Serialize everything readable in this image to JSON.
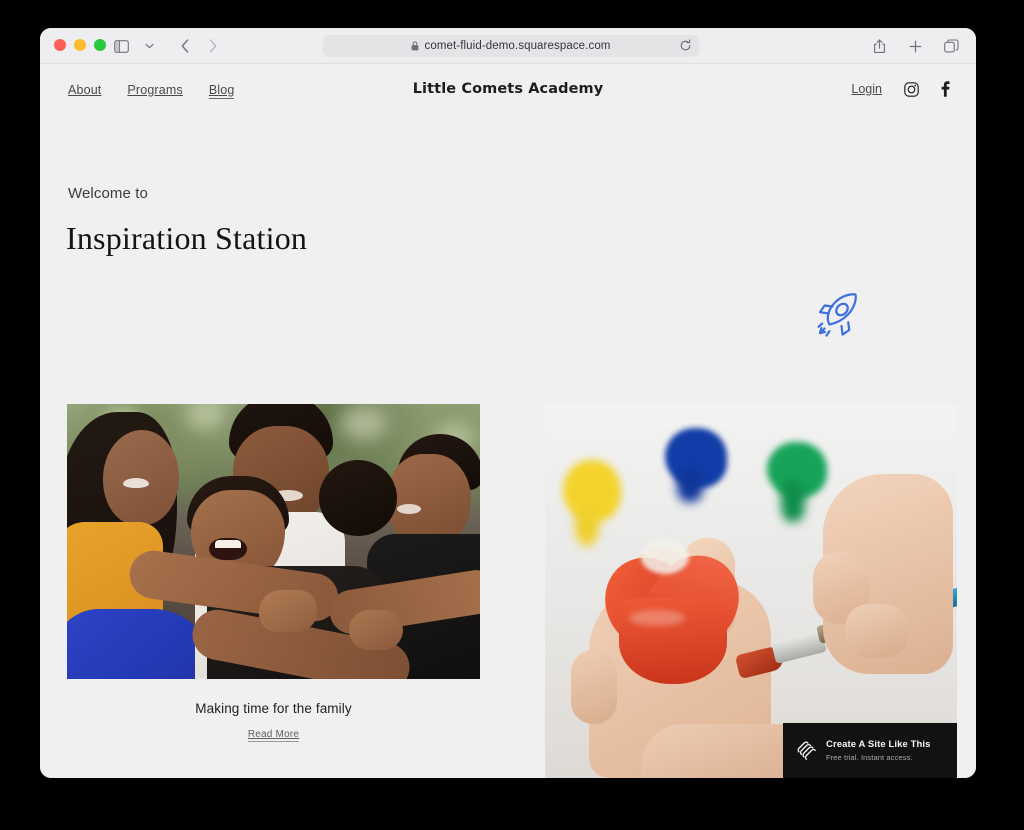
{
  "browser": {
    "traffic_lights": [
      "close",
      "minimize",
      "zoom"
    ],
    "sidebar_toggle_icon": "sidebar-icon",
    "tab_overview_chevron_icon": "chevron-down-icon",
    "back_icon": "chevron-left-icon",
    "forward_icon": "chevron-right-icon",
    "url": "comet-fluid-demo.squarespace.com",
    "lock_icon": "lock-icon",
    "reload_icon": "reload-icon",
    "share_icon": "share-icon",
    "new_tab_icon": "plus-icon",
    "tabs_icon": "tabs-icon"
  },
  "site": {
    "title": "Little Comets Academy",
    "nav": [
      {
        "label": "About",
        "active": false
      },
      {
        "label": "Programs",
        "active": false
      },
      {
        "label": "Blog",
        "active": true
      }
    ],
    "login_label": "Login",
    "social": [
      {
        "name": "instagram-icon"
      },
      {
        "name": "facebook-icon"
      }
    ]
  },
  "hero": {
    "eyebrow": "Welcome to",
    "title": "Inspiration Station",
    "decor_icon": "rocket-icon",
    "decor_color": "#3c6fe0"
  },
  "posts": [
    {
      "image_alt": "family-hugging-photo",
      "title": "Making time for the family",
      "read_more": "Read More"
    },
    {
      "image_alt": "child-painting-heart-rock-photo",
      "title": "",
      "read_more": ""
    }
  ],
  "promo": {
    "logo_icon": "squarespace-logo-icon",
    "title": "Create A Site Like This",
    "subtitle": "Free trial. Instant access."
  },
  "colors": {
    "page_background": "#f0f0f1",
    "toolbar_background": "#eeeef0",
    "accent_blue": "#3c6fe0",
    "promo_background": "#121212",
    "text_primary": "#1d1d1d",
    "text_secondary": "#4a4a4a"
  }
}
